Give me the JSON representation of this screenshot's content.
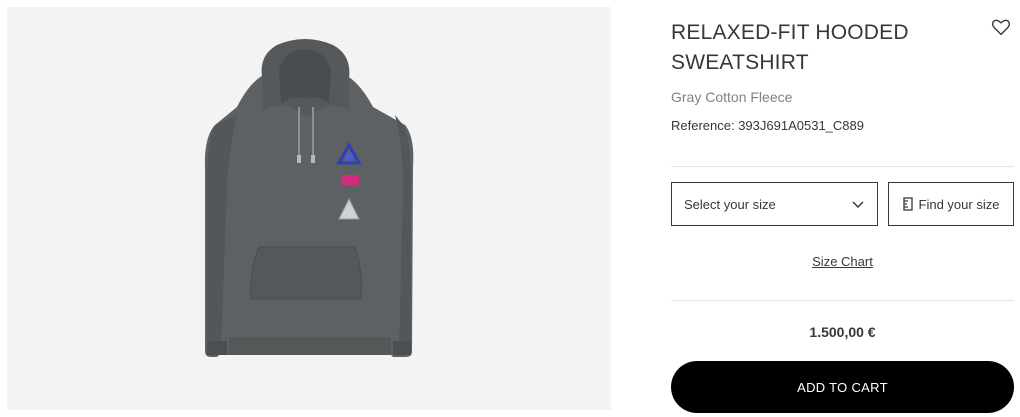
{
  "product": {
    "title_line1": "RELAXED-FIT HOODED",
    "title_line2": "SWEATSHIRT",
    "subtitle": "Gray Cotton Fleece",
    "reference": "Reference: 393J691A0531_C889",
    "price": "1.500,00 €"
  },
  "actions": {
    "size_select_label": "Select your size",
    "find_size_label": "Find your size",
    "size_chart_label": "Size Chart",
    "add_to_cart_label": "ADD TO CART"
  },
  "icons": {
    "wishlist": "heart-icon",
    "size_select": "chevron-down-icon",
    "find_size": "ruler-icon"
  },
  "colors": {
    "image_background": "#f3f3f3",
    "garment": "#5d6163",
    "cta_background": "#000000",
    "cta_text": "#ffffff",
    "text": "#33383c",
    "muted_text": "#7b8487"
  }
}
